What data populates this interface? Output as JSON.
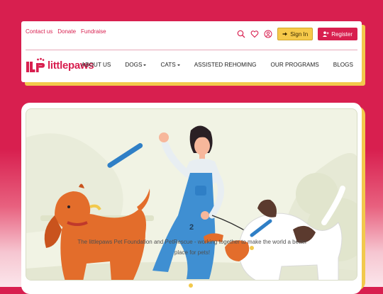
{
  "topbar": {
    "links": [
      "Contact us",
      "Donate",
      "Fundraise"
    ]
  },
  "actions": {
    "signin_label": "Sign In",
    "register_label": "Register"
  },
  "brand": {
    "name": "littlepaws",
    "color": "#d81f4f",
    "accent": "#f2c94c"
  },
  "nav": {
    "items": [
      {
        "label": "ABOUT US",
        "dropdown": false
      },
      {
        "label": "DOGS",
        "dropdown": true
      },
      {
        "label": "CATS",
        "dropdown": true
      },
      {
        "label": "ASSISTED REHOMING",
        "dropdown": false
      },
      {
        "label": "OUR PROGRAMS",
        "dropdown": false
      },
      {
        "label": "BLOGS",
        "dropdown": false
      }
    ]
  },
  "hero": {
    "caption": "The littlepaws Pet Foundation and PetRescue - working together to make the world a better place for pets!",
    "shirt_number": "2"
  },
  "icons": [
    "search-icon",
    "heart-icon",
    "user-icon",
    "sign-in-icon",
    "user-plus-icon"
  ]
}
